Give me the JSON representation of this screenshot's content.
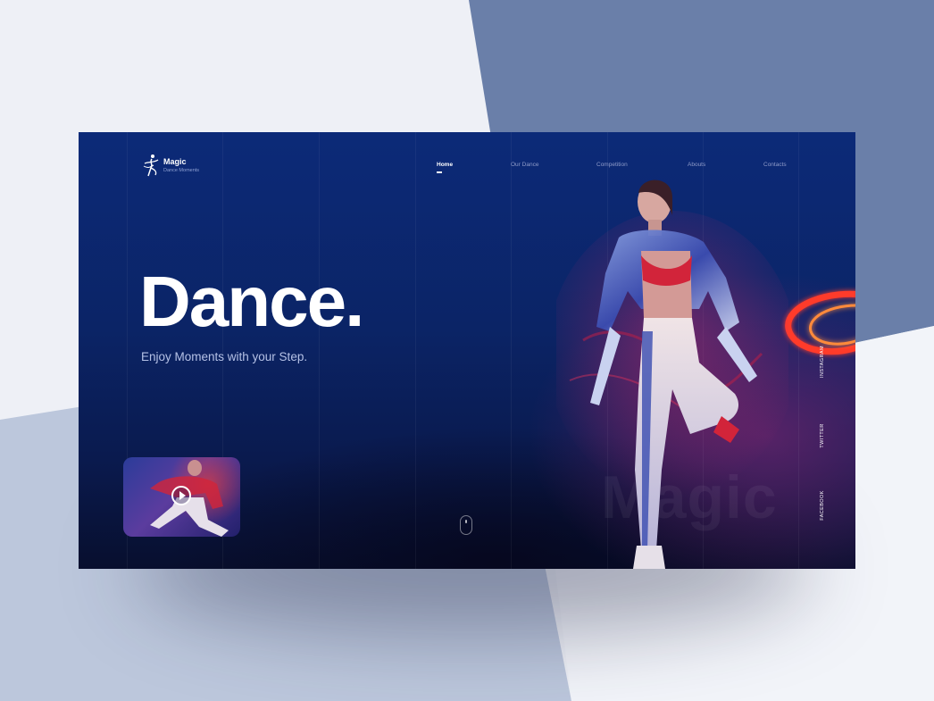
{
  "brand": {
    "name": "Magic",
    "tagline": "Dance Moments",
    "logo_icon": "dancer-logo-icon"
  },
  "nav": {
    "items": [
      {
        "label": "Home",
        "active": true
      },
      {
        "label": "Our Dance",
        "active": false
      },
      {
        "label": "Competition",
        "active": false
      },
      {
        "label": "Abouts",
        "active": false
      },
      {
        "label": "Contacts",
        "active": false
      }
    ]
  },
  "hero": {
    "title": "Dance.",
    "subtitle": "Enjoy Moments with your Step."
  },
  "watermark": "Magic",
  "video": {
    "play_icon": "play-icon"
  },
  "scroll": {
    "icon": "mouse-scroll-icon"
  },
  "social": {
    "items": [
      "INSTAGRAM",
      "TWITTER",
      "FACEBOOK"
    ]
  },
  "colors": {
    "page_background": "#eef0f6",
    "card_background": "#0b2466",
    "accent_top_right": "#6a7fa9",
    "neon_red": "#ff3a2a",
    "text_primary": "#ffffff",
    "text_muted": "#8f9bc8"
  }
}
